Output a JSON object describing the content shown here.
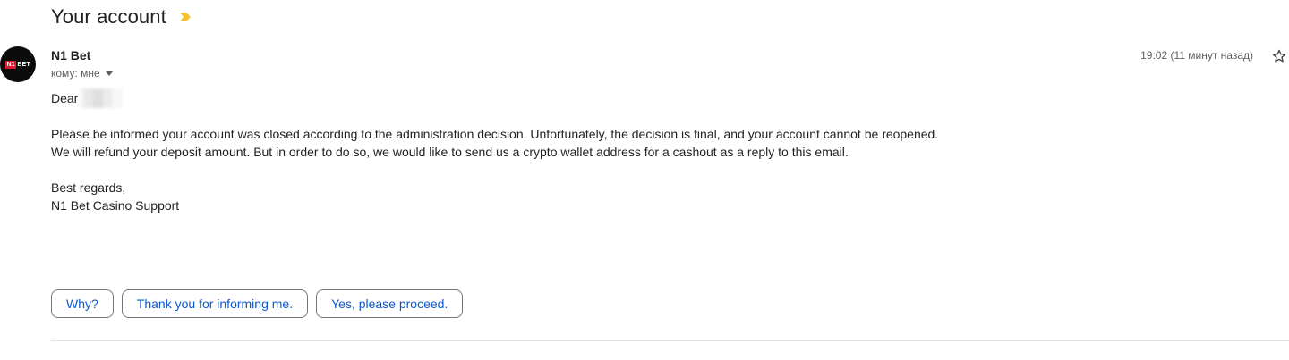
{
  "email": {
    "subject": "Your account",
    "sender": {
      "name": "N1 Bet",
      "avatar_logo_badge": "N1",
      "avatar_logo_text": "BET"
    },
    "recipient_label": "кому: мне",
    "timestamp": "19:02 (11 минут назад)",
    "body": {
      "greeting": "Dear",
      "paragraph_1_line_1": "Please be informed your account was closed according to the administration decision. Unfortunately, the decision is final, and your account cannot be reopened.",
      "paragraph_1_line_2": "We will refund your deposit amount. But in order to do so, we would like to send us a crypto wallet address for a cashout as a reply to this email.",
      "signoff": "Best regards,",
      "signature": "N1 Bet Casino Support"
    }
  },
  "smart_replies": [
    {
      "label": "Why?"
    },
    {
      "label": "Thank you for informing me."
    },
    {
      "label": "Yes, please proceed."
    }
  ],
  "icons": {
    "importance": "importance-marker-icon",
    "expand_recipients": "chevron-down-icon",
    "star": "star-icon"
  },
  "colors": {
    "importance_marker": "#f2c230",
    "chip_text": "#0b57d0",
    "chip_border": "#747775",
    "avatar_bg": "#0b0b0b",
    "avatar_accent": "#e0182d"
  }
}
